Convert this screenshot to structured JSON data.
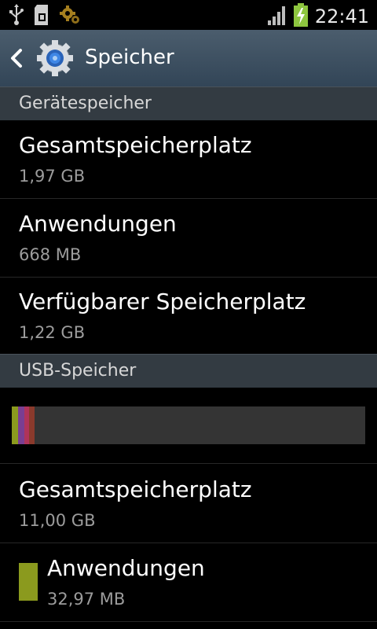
{
  "status_bar": {
    "time": "22:41",
    "icons": [
      "usb-icon",
      "sd-card-icon",
      "gear-notification-icon",
      "signal-icon",
      "battery-charging-icon"
    ]
  },
  "header": {
    "title": "Speicher"
  },
  "device_storage": {
    "section_title": "Gerätespeicher",
    "items": [
      {
        "label": "Gesamtspeicherplatz",
        "value": "1,97 GB"
      },
      {
        "label": "Anwendungen",
        "value": "668 MB"
      },
      {
        "label": "Verfügbarer Speicherplatz",
        "value": "1,22 GB"
      }
    ]
  },
  "usb_storage": {
    "section_title": "USB-Speicher",
    "usage_bar": {
      "segments": [
        {
          "color": "#8b9a1e",
          "fraction": 0.018
        },
        {
          "color": "#7a3e92",
          "fraction": 0.018
        },
        {
          "color": "#b0335a",
          "fraction": 0.012
        },
        {
          "color": "#8a3a2c",
          "fraction": 0.016
        }
      ]
    },
    "items": [
      {
        "label": "Gesamtspeicherplatz",
        "value": "11,00 GB"
      },
      {
        "label": "Anwendungen",
        "value": "32,97 MB",
        "swatch_color": "#8b9a1e"
      }
    ]
  }
}
